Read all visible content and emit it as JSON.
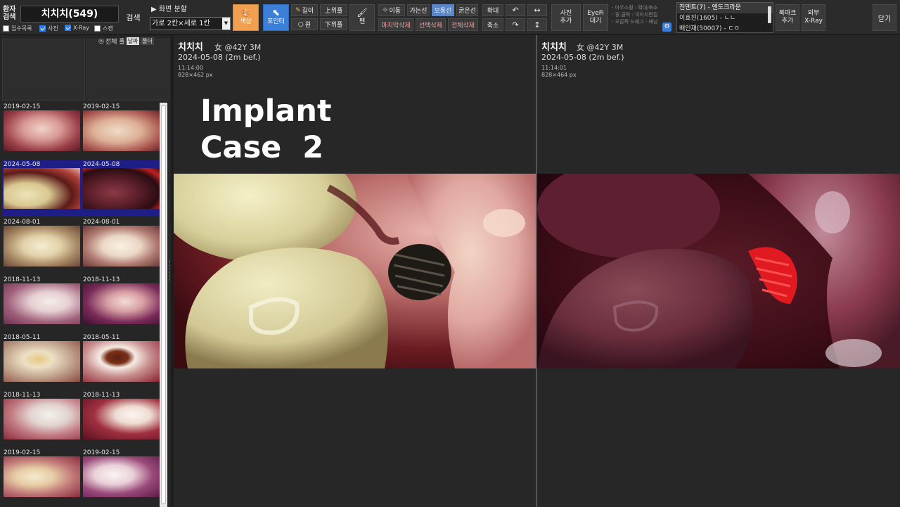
{
  "toolbar": {
    "patient_search_label": "환자\n검색",
    "patient_name_field": "치치치(549)",
    "search_button": "검색",
    "screen_split_label": "▶ 화면 분할",
    "split_select_value": "가로 2칸×세로 1칸",
    "checkboxes": [
      {
        "label": "접수목록",
        "checked": false
      },
      {
        "label": "사진",
        "checked": true
      },
      {
        "label": "X-Ray",
        "checked": true
      },
      {
        "label": "스캔",
        "checked": false
      }
    ],
    "color_button": "색상",
    "pointer_button": "포인터",
    "length_button": "길이",
    "circle_button": "원",
    "overlay_up_button": "上위플",
    "overlay_down_button": "下위플",
    "pen_button": "펜",
    "move_button": "이동",
    "thin_line_button": "가는선",
    "normal_line_button": "보통선",
    "thick_line_button": "굵은선",
    "delete_last_button": "마지막삭제",
    "delete_selected_button": "선택삭제",
    "delete_all_button": "전체삭제",
    "zoom_in_button": "확대",
    "zoom_out_button": "축소",
    "rotate_left_icon": "↶",
    "rotate_right_icon": "↷",
    "flip_h_icon": "↔",
    "flip_v_icon": "↕",
    "add_photo_button": "사진\n추가",
    "eyefi_button": "EyeFi\n대기",
    "help_lines": [
      "- 마우스휠 : 확대/축소",
      "- 휠 클릭 : 이미지편집",
      "- 오른쪽 드래그 : 패닝"
    ],
    "bookmark_items": [
      "진덴트(7) - 엔도크라운",
      "이효진(1605) - ㄴㄴ",
      "배인재(50007) - ㄷㅇ"
    ],
    "add_bookmark_button": "북마크\n추가",
    "external_xray_button": "외부\nX-Ray",
    "close_button": "닫기"
  },
  "sidebar": {
    "filter_all_label": "전체 폴",
    "date_tab": "날짜",
    "folder_tab": "폴더",
    "thumbnails": [
      {
        "date": "2019-02-15",
        "selected": false
      },
      {
        "date": "2019-02-15",
        "selected": false
      },
      {
        "date": "2024-05-08",
        "selected": true
      },
      {
        "date": "2024-05-08",
        "selected": true
      },
      {
        "date": "2024-08-01",
        "selected": false
      },
      {
        "date": "2024-08-01",
        "selected": false
      },
      {
        "date": "2018-11-13",
        "selected": false
      },
      {
        "date": "2018-11-13",
        "selected": false
      },
      {
        "date": "2018-05-11",
        "selected": false
      },
      {
        "date": "2018-05-11",
        "selected": false
      },
      {
        "date": "2018-11-13",
        "selected": false
      },
      {
        "date": "2018-11-13",
        "selected": false
      },
      {
        "date": "2019-02-15",
        "selected": false
      },
      {
        "date": "2019-02-15",
        "selected": false
      }
    ]
  },
  "viewer": {
    "left": {
      "name": "치치치",
      "info": "女 @42Y 3M",
      "date": "2024-05-08 (2m bef.)",
      "time": "11:14:00",
      "size": "828×462 px"
    },
    "right": {
      "name": "치치치",
      "info": "女 @42Y 3M",
      "date": "2024-05-08 (2m bef.)",
      "time": "11:14:01",
      "size": "828×464 px"
    },
    "overlay_text": "Implant\nCase  2"
  },
  "colors": {
    "toolbar_bg": "#2b2b2b",
    "selection_blue": "#1e1e86",
    "active_blue": "#3b7fd8",
    "color_button_orange": "#f0a050",
    "delete_red": "#e07070"
  }
}
